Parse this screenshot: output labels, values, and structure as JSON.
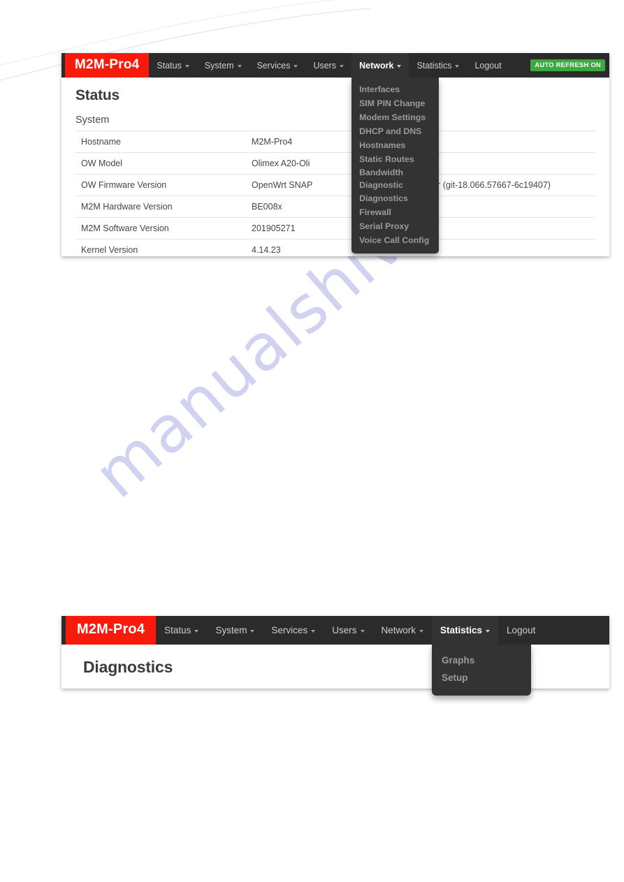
{
  "watermark": {
    "text": "manualshive.com"
  },
  "screen1": {
    "navbar": {
      "brand": "M2M-Pro4",
      "items": [
        {
          "label": "Status",
          "has_caret": true,
          "open": false
        },
        {
          "label": "System",
          "has_caret": true,
          "open": false
        },
        {
          "label": "Services",
          "has_caret": true,
          "open": false
        },
        {
          "label": "Users",
          "has_caret": true,
          "open": false
        },
        {
          "label": "Network",
          "has_caret": true,
          "open": true
        },
        {
          "label": "Statistics",
          "has_caret": true,
          "open": false
        },
        {
          "label": "Logout",
          "has_caret": false,
          "open": false
        }
      ],
      "refresh_badge": "AUTO REFRESH ON",
      "refresh_badge_color": "#3aa93f",
      "brand_color": "#f91a0c",
      "bar_color": "#2b2b2b"
    },
    "network_dropdown": {
      "items": [
        "Interfaces",
        "SIM PIN Change",
        "Modem Settings",
        "DHCP and DNS",
        "Hostnames",
        "Static Routes",
        "Bandwidth Diagnostic",
        "Diagnostics",
        "Firewall",
        "Serial Proxy",
        "Voice Call Config"
      ]
    },
    "page_title": "Status",
    "section_title": "System",
    "table": {
      "rows": [
        {
          "key": "Hostname",
          "value": "M2M-Pro4"
        },
        {
          "key": "OW Model",
          "value": "Olimex A20-Oli"
        },
        {
          "key": "OW Firmware Version",
          "value": "OpenWrt SNAP",
          "value2": "CI Master (git-18.066.57667-6c19407)"
        },
        {
          "key": "M2M Hardware Version",
          "value": "BE008x"
        },
        {
          "key": "M2M Software Version",
          "value": "201905271"
        },
        {
          "key": "Kernel Version",
          "value": "4.14.23"
        }
      ]
    }
  },
  "screen2": {
    "navbar": {
      "brand": "M2M-Pro4",
      "items": [
        {
          "label": "Status",
          "has_caret": true,
          "open": false
        },
        {
          "label": "System",
          "has_caret": true,
          "open": false
        },
        {
          "label": "Services",
          "has_caret": true,
          "open": false
        },
        {
          "label": "Users",
          "has_caret": true,
          "open": false
        },
        {
          "label": "Network",
          "has_caret": true,
          "open": false
        },
        {
          "label": "Statistics",
          "has_caret": true,
          "open": true
        },
        {
          "label": "Logout",
          "has_caret": false,
          "open": false
        }
      ]
    },
    "statistics_dropdown": {
      "items": [
        "Graphs",
        "Setup"
      ]
    },
    "page_title": "Diagnostics"
  }
}
